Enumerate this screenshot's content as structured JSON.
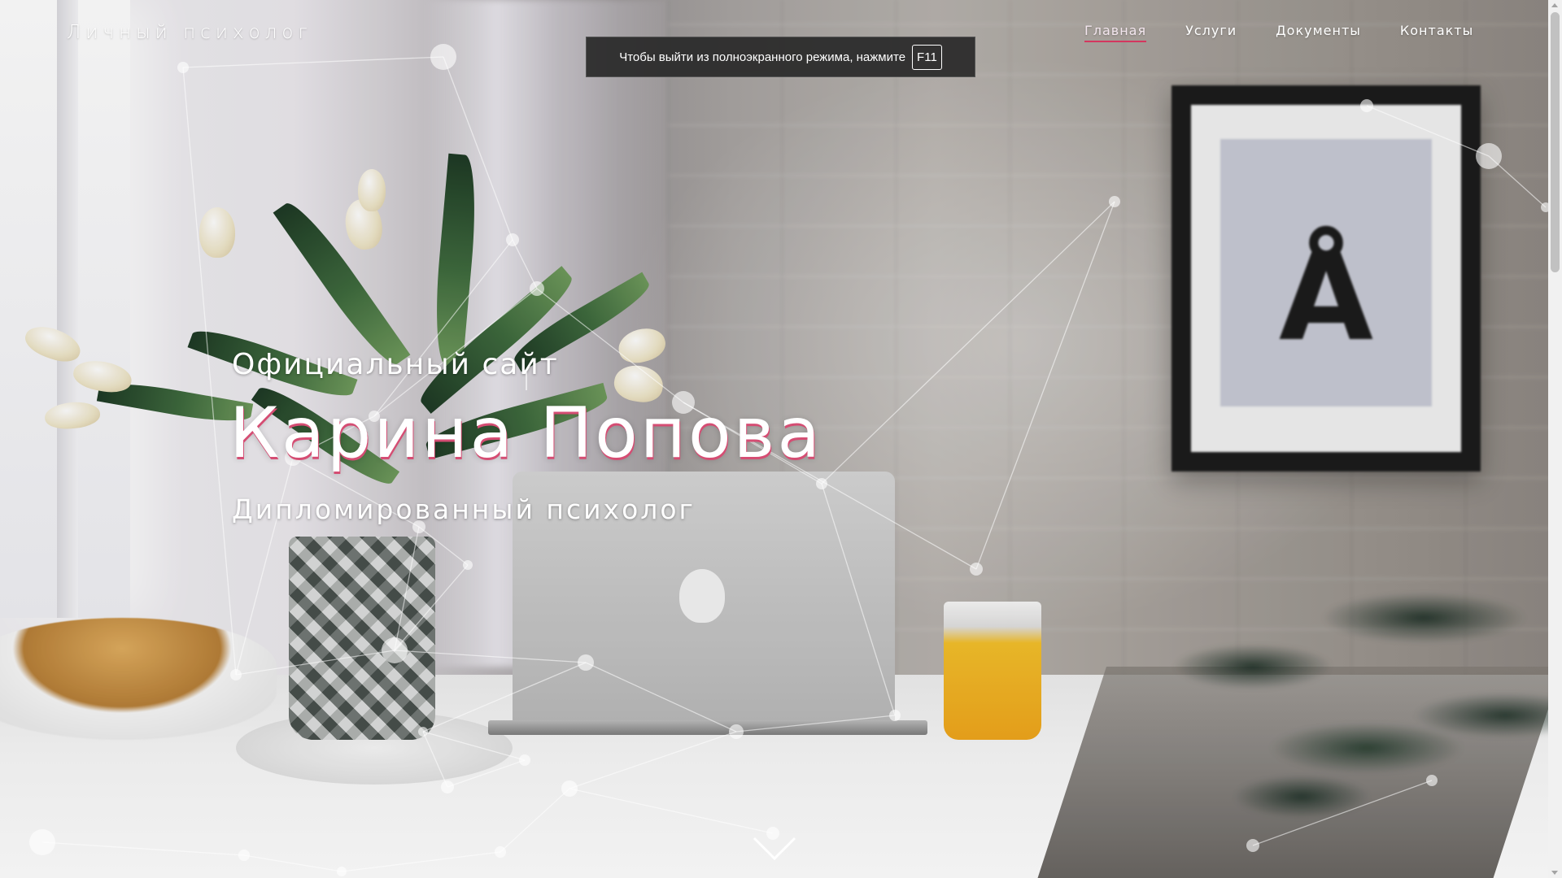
{
  "header": {
    "logo": "Личный психолог",
    "nav": [
      {
        "label": "Главная",
        "active": true
      },
      {
        "label": "Услуги",
        "active": false
      },
      {
        "label": "Документы",
        "active": false
      },
      {
        "label": "Контакты",
        "active": false
      }
    ]
  },
  "fullscreen_notice": {
    "text": "Чтобы выйти из полноэкранного режима, нажмите",
    "key": "F11"
  },
  "hero": {
    "kicker": "Официальный сайт",
    "name": "Карина Попова",
    "subtitle": "Дипломированный психолог",
    "scroll_icon": "chevron-down-icon",
    "background_image": "workspace-photo"
  },
  "colors": {
    "accent": "#d4375f",
    "name_shadow": "#d54d73",
    "toast_bg": "#282828",
    "text": "#ffffff"
  }
}
